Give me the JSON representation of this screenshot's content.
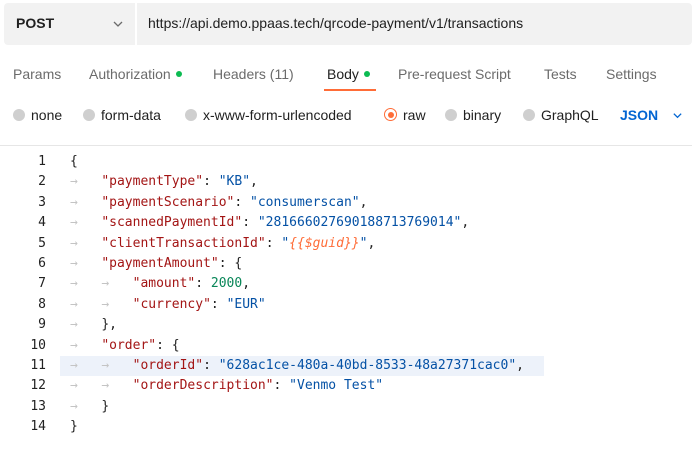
{
  "request": {
    "method": "POST",
    "url": "https://api.demo.ppaas.tech/qrcode-payment/v1/transactions"
  },
  "tabs": [
    {
      "label": "Params",
      "dot": false
    },
    {
      "label": "Authorization",
      "dot": true
    },
    {
      "label": "Headers (11)",
      "dot": false
    },
    {
      "label": "Body",
      "dot": true
    },
    {
      "label": "Pre-request Script",
      "dot": false
    },
    {
      "label": "Tests",
      "dot": false
    },
    {
      "label": "Settings",
      "dot": false
    }
  ],
  "active_tab": "Body",
  "body_types": [
    {
      "label": "none",
      "selected": false
    },
    {
      "label": "form-data",
      "selected": false
    },
    {
      "label": "x-www-form-urlencoded",
      "selected": false
    },
    {
      "label": "raw",
      "selected": true
    },
    {
      "label": "binary",
      "selected": false
    },
    {
      "label": "GraphQL",
      "selected": false
    }
  ],
  "format": "JSON",
  "colors": {
    "accent": "#ff6c37",
    "dot_green": "#0cbb52",
    "format_blue": "#0265d2",
    "highlight_line": "#edf2fa"
  },
  "editor": {
    "highlighted_line": 11,
    "lines": [
      {
        "n": "1",
        "indent": 0,
        "parts": [
          [
            "p",
            "{"
          ]
        ]
      },
      {
        "n": "2",
        "indent": 1,
        "parts": [
          [
            "k",
            "\"paymentType\""
          ],
          [
            "p",
            ": "
          ],
          [
            "s",
            "\"KB\""
          ],
          [
            "p",
            ","
          ]
        ]
      },
      {
        "n": "3",
        "indent": 1,
        "parts": [
          [
            "k",
            "\"paymentScenario\""
          ],
          [
            "p",
            ": "
          ],
          [
            "s",
            "\"consumerscan\""
          ],
          [
            "p",
            ","
          ]
        ]
      },
      {
        "n": "4",
        "indent": 1,
        "parts": [
          [
            "k",
            "\"scannedPaymentId\""
          ],
          [
            "p",
            ": "
          ],
          [
            "s",
            "\"281666027690188713769014\""
          ],
          [
            "p",
            ","
          ]
        ]
      },
      {
        "n": "5",
        "indent": 1,
        "parts": [
          [
            "k",
            "\"clientTransactionId\""
          ],
          [
            "p",
            ": "
          ],
          [
            "s",
            "\""
          ],
          [
            "v",
            "{{$guid}}"
          ],
          [
            "s",
            "\""
          ],
          [
            "p",
            ","
          ]
        ]
      },
      {
        "n": "6",
        "indent": 1,
        "parts": [
          [
            "k",
            "\"paymentAmount\""
          ],
          [
            "p",
            ": {"
          ]
        ]
      },
      {
        "n": "7",
        "indent": 2,
        "parts": [
          [
            "k",
            "\"amount\""
          ],
          [
            "p",
            ": "
          ],
          [
            "n",
            "2000"
          ],
          [
            "p",
            ","
          ]
        ]
      },
      {
        "n": "8",
        "indent": 2,
        "parts": [
          [
            "k",
            "\"currency\""
          ],
          [
            "p",
            ": "
          ],
          [
            "s",
            "\"EUR\""
          ]
        ]
      },
      {
        "n": "9",
        "indent": 1,
        "parts": [
          [
            "p",
            "},"
          ]
        ]
      },
      {
        "n": "10",
        "indent": 1,
        "parts": [
          [
            "k",
            "\"order\""
          ],
          [
            "p",
            ": {"
          ]
        ]
      },
      {
        "n": "11",
        "indent": 2,
        "parts": [
          [
            "k",
            "\"orderId\""
          ],
          [
            "p",
            ": "
          ],
          [
            "s",
            "\"628ac1ce-480a-40bd-8533-48a27371cac0\""
          ],
          [
            "p",
            ","
          ]
        ]
      },
      {
        "n": "12",
        "indent": 2,
        "parts": [
          [
            "k",
            "\"orderDescription\""
          ],
          [
            "p",
            ": "
          ],
          [
            "s",
            "\"Venmo Test\""
          ]
        ]
      },
      {
        "n": "13",
        "indent": 1,
        "parts": [
          [
            "p",
            "}"
          ]
        ]
      },
      {
        "n": "14",
        "indent": 0,
        "parts": [
          [
            "p",
            "}"
          ]
        ]
      }
    ]
  }
}
